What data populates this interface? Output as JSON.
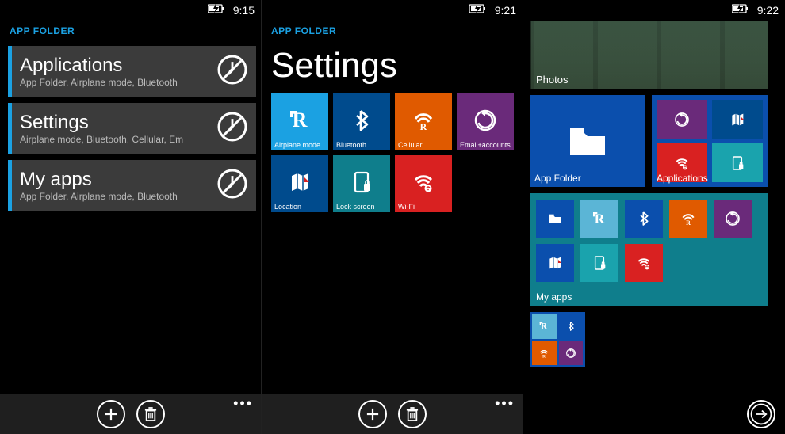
{
  "screens": {
    "s1": {
      "time": "9:15",
      "brand": "APP FOLDER",
      "folders": [
        {
          "title": "Applications",
          "sub": "App Folder, Airplane mode, Bluetooth"
        },
        {
          "title": "Settings",
          "sub": "Airplane mode, Bluetooth, Cellular, Em"
        },
        {
          "title": "My apps",
          "sub": "App Folder, Airplane mode, Bluetooth"
        }
      ]
    },
    "s2": {
      "time": "9:21",
      "brand": "APP FOLDER",
      "pageTitle": "Settings",
      "tiles": [
        {
          "label": "Airplane mode",
          "icon": "airplane",
          "color": "c-blue"
        },
        {
          "label": "Bluetooth",
          "icon": "bluetooth",
          "color": "c-navy"
        },
        {
          "label": "Cellular",
          "icon": "cellular",
          "color": "c-orange"
        },
        {
          "label": "Email+accounts",
          "icon": "sync",
          "color": "c-purple"
        },
        {
          "label": "Location",
          "icon": "map",
          "color": "c-navy"
        },
        {
          "label": "Lock screen",
          "icon": "lock",
          "color": "c-teal"
        },
        {
          "label": "Wi-Fi",
          "icon": "wifi",
          "color": "c-red"
        }
      ]
    },
    "s3": {
      "time": "9:22",
      "photosLabel": "Photos",
      "appFolderLabel": "App Folder",
      "applicationsLabel": "Applications",
      "myAppsLabel": "My apps",
      "applicationsMini": [
        {
          "icon": "sync",
          "color": "c-purple"
        },
        {
          "icon": "map",
          "color": "c-navy"
        },
        {
          "icon": "wifi",
          "color": "c-red"
        },
        {
          "icon": "lock",
          "color": "c-tealL"
        }
      ],
      "myAppsMini": [
        {
          "icon": "folder",
          "color": "c-cobalt"
        },
        {
          "icon": "airplane",
          "color": "c-cyan"
        },
        {
          "icon": "bluetooth",
          "color": "c-cobalt"
        },
        {
          "icon": "cellular",
          "color": "c-orange"
        },
        {
          "icon": "sync",
          "color": "c-purple"
        },
        {
          "icon": "map",
          "color": "c-cobalt"
        },
        {
          "icon": "lock",
          "color": "c-tealL"
        },
        {
          "icon": "wifi",
          "color": "c-red"
        }
      ],
      "smallTileMini": [
        {
          "icon": "airplane",
          "color": "c-cyan"
        },
        {
          "icon": "bluetooth",
          "color": "c-cobalt"
        },
        {
          "icon": "cellular",
          "color": "c-orange"
        },
        {
          "icon": "sync",
          "color": "c-purple"
        }
      ]
    }
  }
}
